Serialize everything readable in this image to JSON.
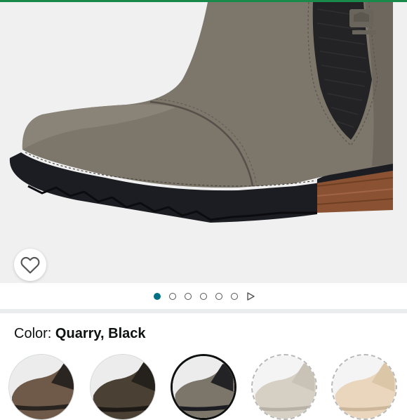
{
  "product": {
    "color_label": "Color:",
    "color_value": "Quarry, Black"
  },
  "gallery": {
    "image_count": 6,
    "active_index": 0,
    "has_video": true
  },
  "swatches": [
    {
      "name": "variant-1",
      "state": "available",
      "fill": "#6f5a4a"
    },
    {
      "name": "variant-2",
      "state": "available",
      "fill": "#4b4034"
    },
    {
      "name": "variant-3",
      "state": "selected",
      "fill": "#7b756a"
    },
    {
      "name": "variant-4",
      "state": "unavailable",
      "fill": "#d6cfc3"
    },
    {
      "name": "variant-5",
      "state": "unavailable",
      "fill": "#e9d6bd"
    }
  ],
  "colors": {
    "accent_active_dot": "#007185",
    "header_strip": "#1a8a4a",
    "boot_leather": "#7d766b",
    "boot_sole": "#1c1d22"
  }
}
